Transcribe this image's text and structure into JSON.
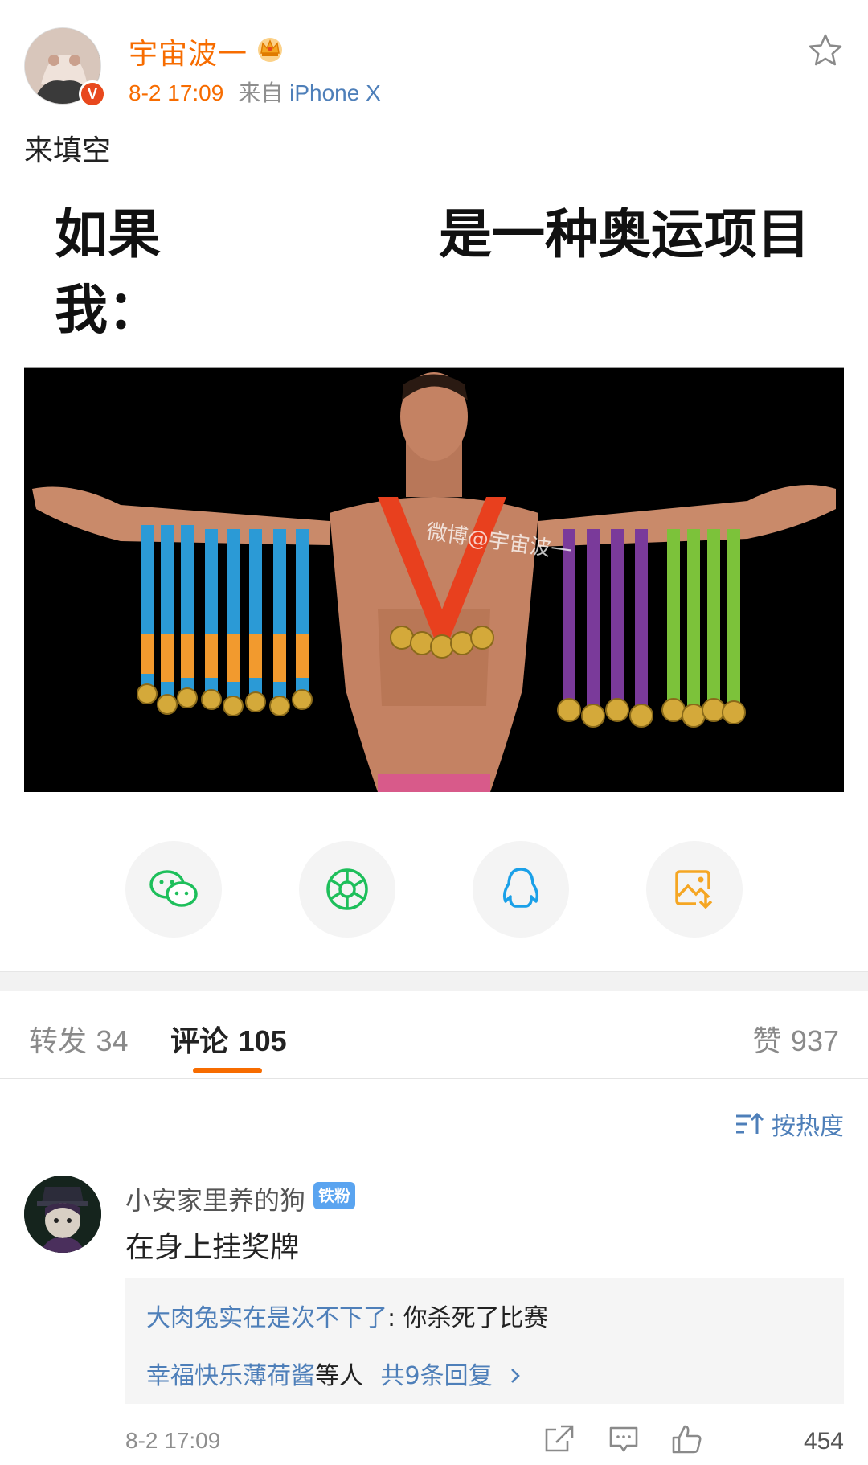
{
  "post": {
    "username": "宇宙波一",
    "time": "8-2 17:09",
    "from_label": "来自",
    "device": "iPhone X",
    "text": "来填空",
    "colors": {
      "accent": "#f76c00",
      "link": "#4e7fb9"
    }
  },
  "meme": {
    "line_left": "如果\n我：",
    "line_right": "是一种奥运项目",
    "watermark": "微博@宇宙波一"
  },
  "share": {
    "items": [
      {
        "icon": "wechat-icon"
      },
      {
        "icon": "moments-icon"
      },
      {
        "icon": "qq-icon"
      },
      {
        "icon": "save-image-icon"
      }
    ]
  },
  "tabs": {
    "repost_label": "转发",
    "repost_count": "34",
    "comment_label": "评论",
    "comment_count": "105",
    "like_label": "赞",
    "like_count": "937"
  },
  "sort": {
    "label": "按热度"
  },
  "comment": {
    "name": "小安家里养的狗",
    "badge": "铁粉",
    "text": "在身上挂奖牌",
    "reply_user": "大肉兔实在是次不下了",
    "reply_text": ": 你杀死了比赛",
    "reply_more_users": "幸福快乐薄荷酱",
    "reply_more_suffix": "等人",
    "reply_total": "共9条回复",
    "time": "8-2 17:09",
    "likes": "454"
  }
}
